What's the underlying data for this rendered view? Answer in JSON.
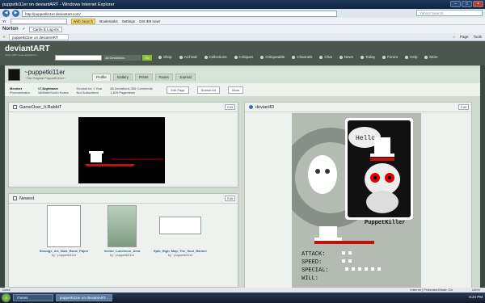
{
  "window": {
    "title": "puppetki11er on deviantART - Windows Internet Explorer"
  },
  "browser": {
    "url": "http://puppetki11er.deviantart.com/",
    "search_placeholder": "Yahoo! Search",
    "toolbar1": {
      "web_search": "Web Search",
      "bookmarks": "Bookmarks",
      "settings": "Settings",
      "get": "Get IE8 now!"
    },
    "toolbar2": {
      "norton": "Norton",
      "cards": "Cards & Log-ins"
    },
    "tab": "puppetki11er on deviantART",
    "tools": [
      "Page",
      "Tools"
    ]
  },
  "da": {
    "logo": "deviantART",
    "logo_sub": "where ART meets application!",
    "search_value": "",
    "scope": "All Deviations",
    "go": "Go",
    "nav": [
      "Shop",
      "Archival",
      "Collections",
      "Critiques",
      "Critiqueable",
      "Channels",
      "Chat",
      "News",
      "Today",
      "Forum",
      "Help",
      "More"
    ]
  },
  "profile": {
    "username": "~puppetki11er",
    "tagline": "~The Original PuppetKi11er~",
    "tabs": [
      "Profile",
      "Gallery",
      "Prints",
      "Faves",
      "Journal"
    ],
    "member_label": "Member",
    "member_sub": "Procrastinator",
    "age": "17,Nightmare",
    "location": "18/Male/South Korea",
    "deviant_for": "Deviant for 1 Year",
    "subscribed": "Not Subscribed",
    "stats": "85 Deviations  306 Comments  1,819 Pageviews",
    "edit_page": "Edit Page",
    "submit_art": "Submit Art",
    "more": "More"
  },
  "panels": {
    "game": {
      "title": "GameOver_It.RabbiT",
      "edit": "Edit"
    },
    "newest": {
      "title": "Newest",
      "edit": "Edit"
    },
    "deviantid": {
      "title": "deviantID",
      "edit": "Edit"
    }
  },
  "newest_items": [
    {
      "title": "Smudge_Art_Note_Book_Paper",
      "by": "by ~puppetki11er"
    },
    {
      "title": "Vector_Luncheon_Area",
      "by": "by ~puppetki11er"
    },
    {
      "title": "Epik_High_Map_The_Soul_Banner",
      "by": "by ~puppetki11er"
    }
  ],
  "deviantid_art": {
    "speech": "Hello",
    "name": "PuppetKiller",
    "stats": [
      "ATTACK:",
      "SPEED:",
      "SPECIAL:",
      "WILL:"
    ]
  },
  "status": {
    "left": "Done",
    "zone": "Internet | Protected Mode: On",
    "zoom": "100%"
  },
  "taskbar": {
    "items": [
      "iTunes",
      "puppetki11er on deviantART..."
    ],
    "time": "8:24 PM"
  }
}
